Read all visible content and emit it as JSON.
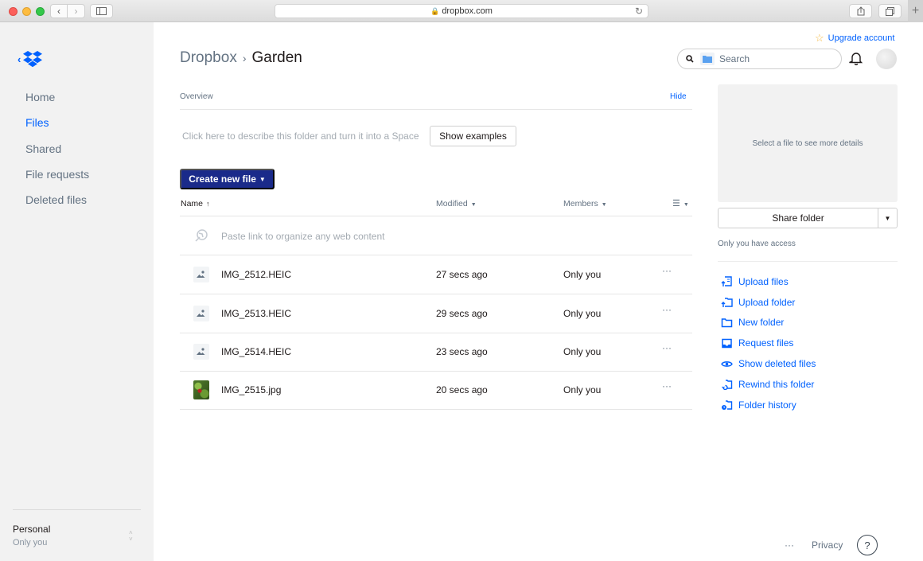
{
  "browser": {
    "url": "dropbox.com",
    "new_tab_label": "+"
  },
  "sidebar": {
    "items": [
      {
        "label": "Home",
        "active": false
      },
      {
        "label": "Files",
        "active": true
      },
      {
        "label": "Shared",
        "active": false
      },
      {
        "label": "File requests",
        "active": false
      },
      {
        "label": "Deleted files",
        "active": false
      }
    ],
    "account": {
      "name": "Personal",
      "sub": "Only you"
    }
  },
  "header": {
    "breadcrumb_root": "Dropbox",
    "breadcrumb_sep": "›",
    "breadcrumb_current": "Garden",
    "upgrade_label": "Upgrade account",
    "search_placeholder": "Search"
  },
  "overview": {
    "label": "Overview",
    "hide_label": "Hide",
    "describe_text": "Click here to describe this folder and turn it into a Space",
    "show_examples_label": "Show examples"
  },
  "toolbar": {
    "create_label": "Create new file"
  },
  "table": {
    "columns": {
      "name": "Name",
      "modified": "Modified",
      "members": "Members"
    },
    "paste_row": "Paste link to organize any web content",
    "rows": [
      {
        "name": "IMG_2512.HEIC",
        "modified": "27 secs ago",
        "members": "Only you",
        "icon": "image-icon"
      },
      {
        "name": "IMG_2513.HEIC",
        "modified": "29 secs ago",
        "members": "Only you",
        "icon": "image-icon"
      },
      {
        "name": "IMG_2514.HEIC",
        "modified": "23 secs ago",
        "members": "Only you",
        "icon": "image-icon"
      },
      {
        "name": "IMG_2515.jpg",
        "modified": "20 secs ago",
        "members": "Only you",
        "icon": "thumbnail"
      }
    ],
    "more_label": "···"
  },
  "details": {
    "placeholder": "Select a file to see more details",
    "share_label": "Share folder",
    "access_text": "Only you have access",
    "actions": [
      {
        "label": "Upload files",
        "icon": "upload-files-icon"
      },
      {
        "label": "Upload folder",
        "icon": "upload-folder-icon"
      },
      {
        "label": "New folder",
        "icon": "new-folder-icon"
      },
      {
        "label": "Request files",
        "icon": "request-files-icon"
      },
      {
        "label": "Show deleted files",
        "icon": "eye-icon"
      },
      {
        "label": "Rewind this folder",
        "icon": "rewind-icon"
      },
      {
        "label": "Folder history",
        "icon": "history-icon"
      }
    ]
  },
  "footer": {
    "more_label": "···",
    "privacy_label": "Privacy",
    "help_label": "?"
  },
  "colors": {
    "accent": "#0061fe",
    "primary_button": "#1a2a8a",
    "sidebar_bg": "#f2f2f2"
  }
}
